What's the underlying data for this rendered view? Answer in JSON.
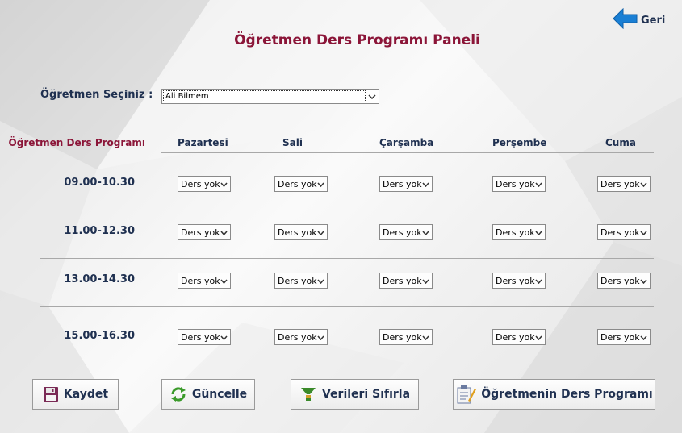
{
  "header": {
    "title": "Öğretmen Ders Programı Paneli",
    "back_label": "Geri"
  },
  "teacher_select": {
    "label": "Öğretmen Seçiniz :",
    "selected": "Ali Bilmem"
  },
  "schedule": {
    "corner_label": "Öğretmen Ders Programı",
    "days": [
      "Pazartesi",
      "Sali",
      "Çarşamba",
      "Perşembe",
      "Cuma"
    ],
    "slots": [
      {
        "time": "09.00-10.30",
        "cells": [
          "Ders yok",
          "Ders yok",
          "Ders yok",
          "Ders yok",
          "Ders yok"
        ]
      },
      {
        "time": "11.00-12.30",
        "cells": [
          "Ders yok",
          "Ders yok",
          "Ders yok",
          "Ders yok",
          "Ders yok"
        ]
      },
      {
        "time": "13.00-14.30",
        "cells": [
          "Ders yok",
          "Ders yok",
          "Ders yok",
          "Ders yok",
          "Ders yok"
        ]
      },
      {
        "time": "15.00-16.30",
        "cells": [
          "Ders yok",
          "Ders yok",
          "Ders yok",
          "Ders yok",
          "Ders yok"
        ]
      }
    ]
  },
  "actions": {
    "save": "Kaydet",
    "update": "Güncelle",
    "reset": "Verileri Sıfırla",
    "teacher_schedule": "Öğretmenin Ders Programı"
  },
  "colors": {
    "title": "#8b1538",
    "text": "#1f3050",
    "back_arrow": "#1a7fd4"
  },
  "icons": {
    "back": "arrow-left-icon",
    "save": "floppy-disk-icon",
    "update": "refresh-icon",
    "reset": "funnel-icon",
    "teacher_schedule": "clipboard-pencil-icon"
  }
}
